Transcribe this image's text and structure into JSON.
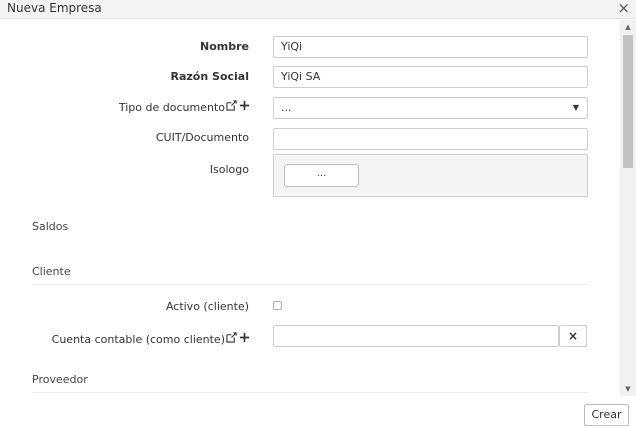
{
  "dialog": {
    "title": "Nueva Empresa",
    "close": "×"
  },
  "form": {
    "nombre": {
      "label": "Nombre",
      "value": "YiQi"
    },
    "razon_social": {
      "label": "Razón Social",
      "value": "YiQi SA"
    },
    "tipo_documento": {
      "label": "Tipo de documento",
      "value": "...",
      "caret": "▼"
    },
    "cuit": {
      "label": "CUIT/Documento",
      "value": ""
    },
    "isologo": {
      "label": "Isologo",
      "button": "..."
    }
  },
  "sections": {
    "saldos": "Saldos",
    "cliente": "Cliente",
    "proveedor": "Proveedor"
  },
  "cliente": {
    "activo": {
      "label": "Activo (cliente)",
      "checked": false
    },
    "cuenta_contable": {
      "label": "Cuenta contable (como cliente)",
      "value": "",
      "clear": "×"
    }
  },
  "scrollbar": {
    "up": "▲",
    "down": "▼"
  },
  "footer": {
    "crear": "Crear"
  },
  "colors": {
    "border": "#cfcfcf",
    "titlebar": "#f3f3f3",
    "isologo_bg": "#f4f4f4"
  }
}
